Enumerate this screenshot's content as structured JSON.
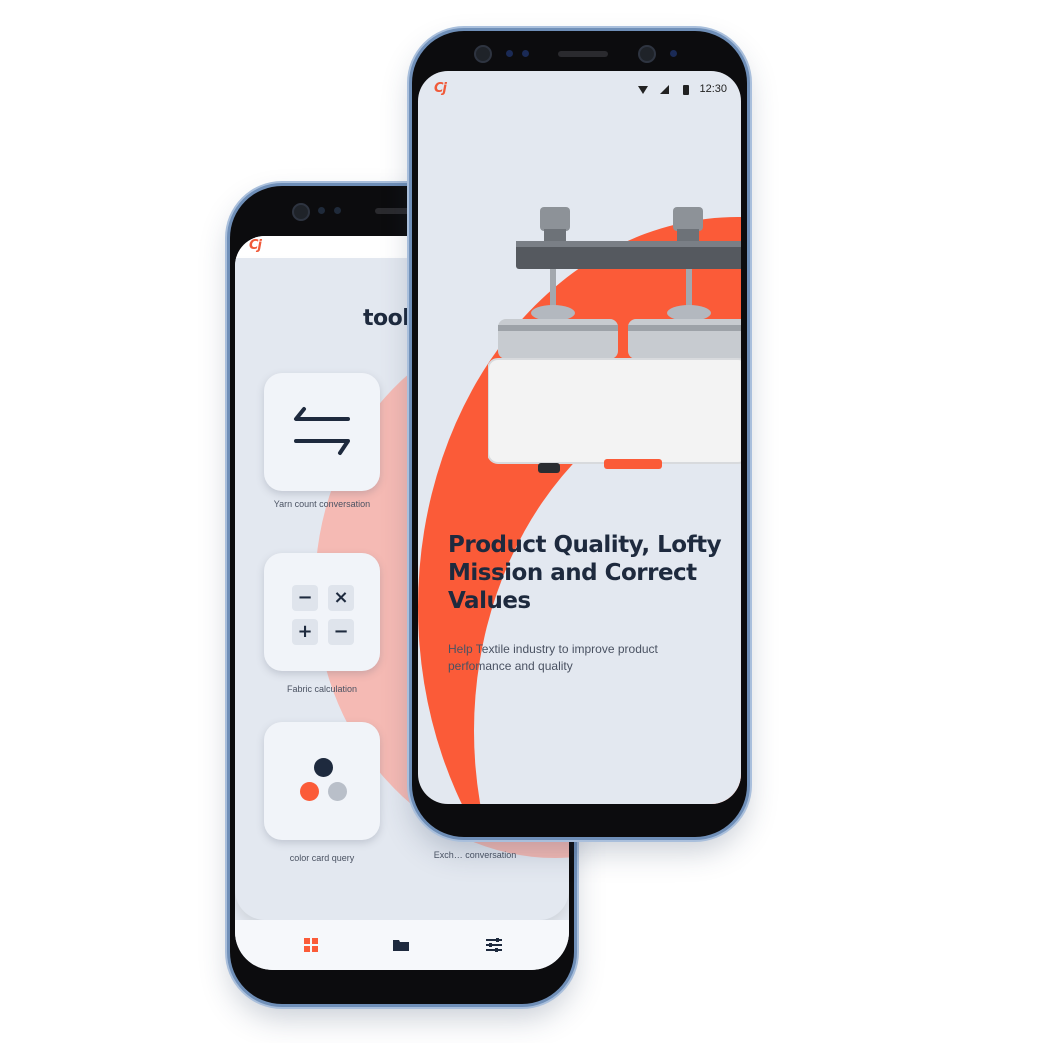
{
  "app": {
    "logo_text": "Cj",
    "accent_color": "#fb5b38",
    "dark_color": "#1e2a3e"
  },
  "toolbox_screen": {
    "title": "toolb",
    "tools": [
      {
        "label": "Yarn count conversation",
        "icon": "swap-arrows-icon"
      },
      {
        "label": "Fabric calculation",
        "icon": "calculator-icon"
      },
      {
        "label": "color card query",
        "icon": "color-dots-icon"
      },
      {
        "label": "Exch… conversation",
        "icon": "exchange-icon"
      }
    ],
    "calculator_symbols": [
      "−",
      "×",
      "+",
      "−"
    ],
    "nav": [
      {
        "name": "grid-icon",
        "glyph": "▦"
      },
      {
        "name": "folder-icon",
        "glyph": "▬"
      },
      {
        "name": "sliders-icon",
        "glyph": "☰"
      }
    ]
  },
  "splash_screen": {
    "status_time": "12:30",
    "headline": "Product Quality, Lofty Mission and Correct Values",
    "subline": "Help Textile industry to improve product perfomance and quality"
  }
}
